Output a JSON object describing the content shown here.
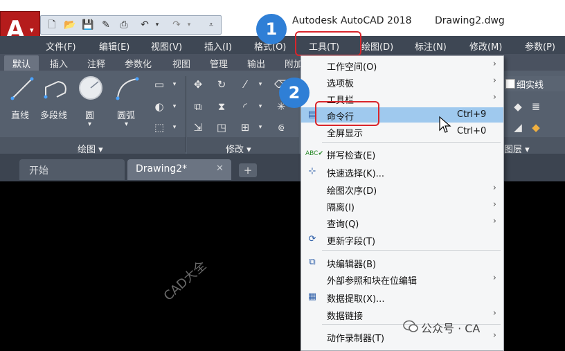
{
  "title_bar": {
    "app_title": "Autodesk AutoCAD 2018",
    "document": "Drawing2.dwg",
    "logo_letter": "A"
  },
  "menu_bar": {
    "items": [
      "文件(F)",
      "编辑(E)",
      "视图(V)",
      "插入(I)",
      "格式(O)",
      "工具(T)",
      "绘图(D)",
      "标注(N)",
      "修改(M)",
      "参数(P)"
    ]
  },
  "ribbon_tabs": [
    "默认",
    "插入",
    "注释",
    "参数化",
    "视图",
    "管理",
    "输出",
    "附加"
  ],
  "ribbon": {
    "draw_tools": [
      "直线",
      "多段线",
      "圆",
      "圆弧"
    ],
    "draw_panel": "绘图 ▾",
    "modify_panel": "修改 ▾",
    "layers_panel": "图层 ▾",
    "linetype": "细实线"
  },
  "file_tabs": {
    "start": "开始",
    "drawing": "Drawing2*",
    "close": "✕",
    "add": "+"
  },
  "dropdown": {
    "items": [
      {
        "label": "工作空间(O)",
        "submenu": true
      },
      {
        "label": "选项板",
        "submenu": true
      },
      {
        "label": "工具栏",
        "submenu": true
      },
      {
        "label": "命令行",
        "shortcut": "Ctrl+9",
        "highlighted": true
      },
      {
        "label": "全屏显示",
        "shortcut": "Ctrl+0"
      },
      {
        "label": "拼写检查(E)"
      },
      {
        "label": "快速选择(K)..."
      },
      {
        "label": "绘图次序(D)",
        "submenu": true
      },
      {
        "label": "隔离(I)",
        "submenu": true
      },
      {
        "label": "查询(Q)",
        "submenu": true
      },
      {
        "label": "更新字段(T)"
      },
      {
        "label": "块编辑器(B)"
      },
      {
        "label": "外部参照和块在位编辑",
        "submenu": true
      },
      {
        "label": "数据提取(X)..."
      },
      {
        "label": "数据链接",
        "submenu": true
      },
      {
        "label": "动作录制器(T)",
        "submenu": true
      }
    ]
  },
  "callouts": [
    "1",
    "2"
  ],
  "watermark": "CAD大全",
  "wechat": "公众号 · CA",
  "colors": {
    "highlight": "#9fc9ee",
    "callout": "#2f7fd6",
    "annotation_red": "#d9252b",
    "menu_bg": "#3e4754"
  }
}
